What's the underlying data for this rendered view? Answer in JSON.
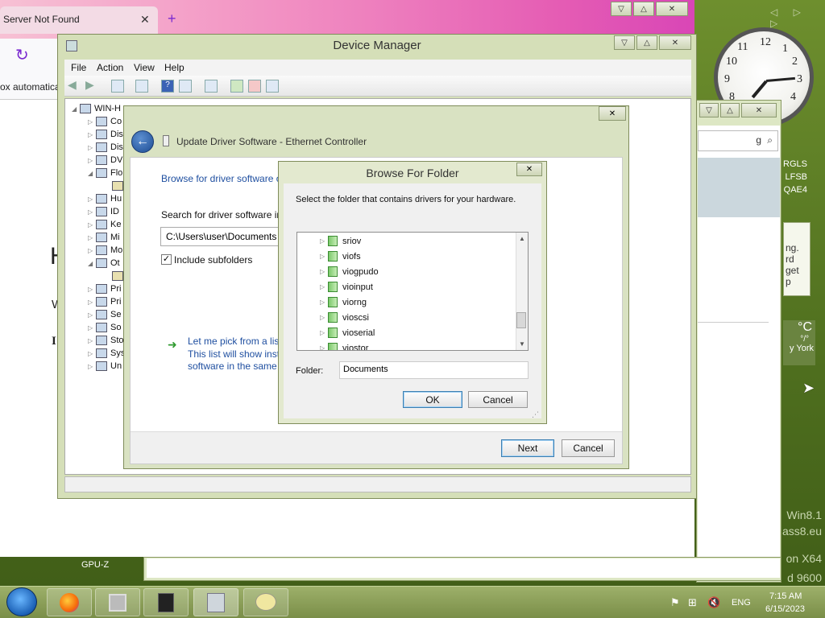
{
  "browser": {
    "tab_title": "Server Not Found",
    "tab_close": "✕",
    "new_tab": "+",
    "notification_fragment": "ox automaticall",
    "content_h_fragment": "H",
    "content_w_fragment": "W",
    "content_i_fragment": "I"
  },
  "desktop": {
    "watermark": [
      "Win8.1",
      "ass8.eu",
      "on X64",
      "d 9600"
    ],
    "gadget_lines": [
      "RGLS",
      "LFSB",
      "QAE4"
    ],
    "gadget2_lines": [
      "ng.",
      "rd",
      "get",
      "p"
    ],
    "weather": {
      "unit": "°C",
      "loc": "y York",
      "sub": "°/°"
    },
    "gpu_label": "GPU-Z",
    "clock_numbers": [
      "12",
      "1",
      "2",
      "3",
      "4",
      "9",
      "10",
      "11",
      "8"
    ]
  },
  "device_manager": {
    "title": "Device Manager",
    "menu": [
      "File",
      "Action",
      "View",
      "Help"
    ],
    "tree_root": "WIN-H",
    "tree_items": [
      "Co",
      "Dis",
      "Dis",
      "DV",
      "Flo",
      "",
      "Hu",
      "ID",
      "Ke",
      "Mi",
      "Mo",
      "Ot",
      "",
      "Pri",
      "Pri",
      "Se",
      "So",
      "Sto",
      "Sys",
      "Un"
    ]
  },
  "update_driver": {
    "title": "Update Driver Software - Ethernet Controller",
    "browse_heading": "Browse for driver software o",
    "search_label": "Search for driver software in",
    "path_value": "C:\\Users\\user\\Documents",
    "include_subfolders": "Include subfolders",
    "pick_line1": "Let me pick from a lis",
    "pick_line2": "This list will show inst",
    "pick_line3": "software in the same",
    "next": "Next",
    "cancel": "Cancel"
  },
  "browse_folder": {
    "title": "Browse For Folder",
    "instructions": "Select the folder that contains drivers for your hardware.",
    "folders": [
      "sriov",
      "viofs",
      "viogpudo",
      "vioinput",
      "viorng",
      "vioscsi",
      "vioserial",
      "viostor"
    ],
    "folder_label": "Folder:",
    "folder_value": "Documents",
    "ok": "OK",
    "cancel": "Cancel"
  },
  "taskbar": {
    "language": "ENG",
    "time": "7:15 AM",
    "date": "6/15/2023"
  }
}
